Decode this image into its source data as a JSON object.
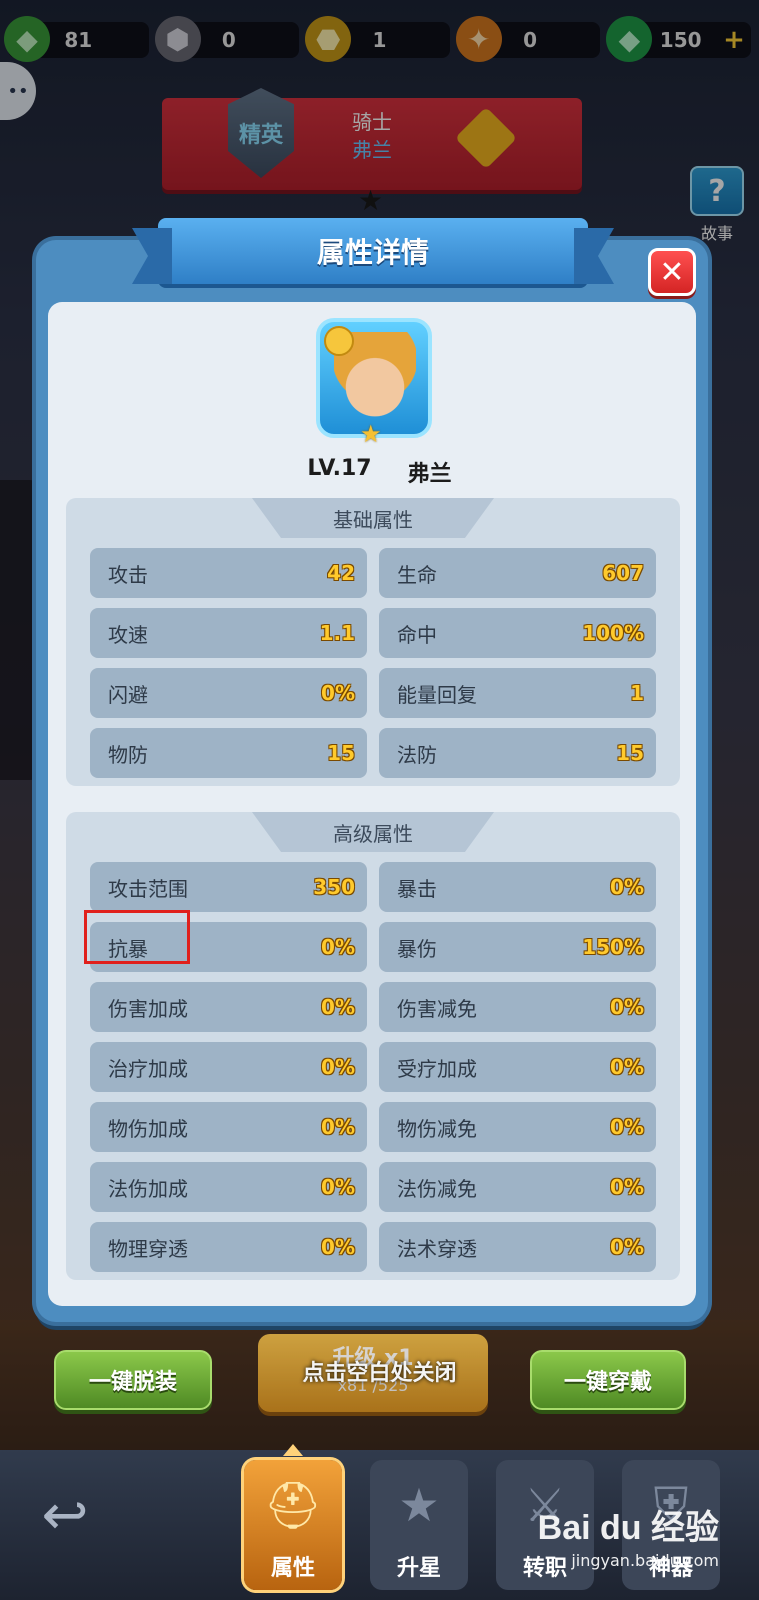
{
  "currencies": [
    {
      "icon": "green-gem-cluster-icon",
      "value": "81",
      "color": "#4cbb4c"
    },
    {
      "icon": "grey-stone-icon",
      "value": "0",
      "color": "#8a8a94"
    },
    {
      "icon": "gold-ore-icon",
      "value": "1",
      "color": "#e6b422"
    },
    {
      "icon": "orange-crystal-icon",
      "value": "0",
      "color": "#f09030"
    },
    {
      "icon": "emerald-icon",
      "value": "150",
      "color": "#2fb85a"
    }
  ],
  "currency_plus": "+",
  "hero_banner": {
    "rank": "精英",
    "class_name": "骑士",
    "hero_name": "弗兰"
  },
  "story_button": {
    "label": "故事",
    "glyph": "?"
  },
  "modal": {
    "title": "属性详情",
    "close_glyph": "✕",
    "hero_level": "LV.17",
    "hero_name": "弗兰",
    "basic": {
      "title": "基础属性",
      "rows": [
        {
          "label": "攻击",
          "value": "42"
        },
        {
          "label": "生命",
          "value": "607"
        },
        {
          "label": "攻速",
          "value": "1.1"
        },
        {
          "label": "命中",
          "value": "100%"
        },
        {
          "label": "闪避",
          "value": "0%"
        },
        {
          "label": "能量回复",
          "value": "1"
        },
        {
          "label": "物防",
          "value": "15"
        },
        {
          "label": "法防",
          "value": "15"
        }
      ]
    },
    "advanced": {
      "title": "高级属性",
      "rows": [
        {
          "label": "攻击范围",
          "value": "350"
        },
        {
          "label": "暴击",
          "value": "0%"
        },
        {
          "label": "抗暴",
          "value": "0%"
        },
        {
          "label": "暴伤",
          "value": "150%"
        },
        {
          "label": "伤害加成",
          "value": "0%"
        },
        {
          "label": "伤害减免",
          "value": "0%"
        },
        {
          "label": "治疗加成",
          "value": "0%"
        },
        {
          "label": "受疗加成",
          "value": "0%"
        },
        {
          "label": "物伤加成",
          "value": "0%"
        },
        {
          "label": "物伤减免",
          "value": "0%"
        },
        {
          "label": "法伤加成",
          "value": "0%"
        },
        {
          "label": "法伤减免",
          "value": "0%"
        },
        {
          "label": "物理穿透",
          "value": "0%"
        },
        {
          "label": "法术穿透",
          "value": "0%"
        }
      ]
    }
  },
  "bottom_actions": {
    "unequip_all": "一键脱装",
    "upgrade": "升级 x1",
    "upgrade_cost": "x81 /525",
    "equip_all": "一键穿戴",
    "close_hint": "点击空白处关闭"
  },
  "nav": {
    "back_glyph": "↩",
    "tabs": [
      {
        "label": "属性",
        "icon": "knight-helmet-icon",
        "glyph": "⛑",
        "active": true
      },
      {
        "label": "升星",
        "icon": "star-icon",
        "glyph": "★",
        "active": false
      },
      {
        "label": "转职",
        "icon": "sword-icon",
        "glyph": "⚔",
        "active": false
      },
      {
        "label": "神器",
        "icon": "shield-icon",
        "glyph": "⛨",
        "active": false
      }
    ]
  },
  "watermark": {
    "logo": "Bai du 经验",
    "url": "jingyan.baidu.com"
  },
  "colors": {
    "accent_blue": "#4d8dc0",
    "value_yellow": "#ffca2c",
    "highlight_red": "#e0201c"
  }
}
